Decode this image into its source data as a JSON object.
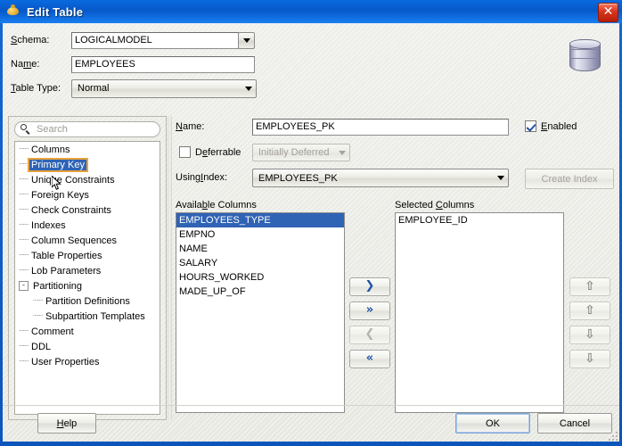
{
  "window": {
    "title": "Edit Table",
    "title_icon": "teapot-icon",
    "close_label": "✕",
    "close_icon": "close-icon",
    "side_icon": "database-cylinder-icon"
  },
  "top_form": {
    "schema": {
      "label": "Schema:",
      "value": "LOGICALMODEL",
      "dropdown_icon": "chevron-down-icon"
    },
    "name": {
      "label": "Name:",
      "value": "EMPLOYEES"
    },
    "table_type": {
      "label": "Table Type:",
      "value": "Normal",
      "dropdown_icon": "chevron-down-icon"
    }
  },
  "sidebar": {
    "search": {
      "placeholder": "Search",
      "icon": "search-icon",
      "value": ""
    },
    "tree": [
      {
        "label": "Columns",
        "indent": 0,
        "selected": false,
        "expander": ""
      },
      {
        "label": "Primary Key",
        "indent": 0,
        "selected": true,
        "expander": ""
      },
      {
        "label": "Unique Constraints",
        "indent": 0,
        "selected": false,
        "expander": ""
      },
      {
        "label": "Foreign Keys",
        "indent": 0,
        "selected": false,
        "expander": ""
      },
      {
        "label": "Check Constraints",
        "indent": 0,
        "selected": false,
        "expander": ""
      },
      {
        "label": "Indexes",
        "indent": 0,
        "selected": false,
        "expander": ""
      },
      {
        "label": "Column Sequences",
        "indent": 0,
        "selected": false,
        "expander": ""
      },
      {
        "label": "Table Properties",
        "indent": 0,
        "selected": false,
        "expander": ""
      },
      {
        "label": "Lob Parameters",
        "indent": 0,
        "selected": false,
        "expander": ""
      },
      {
        "label": "Partitioning",
        "indent": 0,
        "selected": false,
        "expander": "-"
      },
      {
        "label": "Partition Definitions",
        "indent": 1,
        "selected": false,
        "expander": ""
      },
      {
        "label": "Subpartition Templates",
        "indent": 1,
        "selected": false,
        "expander": ""
      },
      {
        "label": "Comment",
        "indent": 0,
        "selected": false,
        "expander": ""
      },
      {
        "label": "DDL",
        "indent": 0,
        "selected": false,
        "expander": ""
      },
      {
        "label": "User Properties",
        "indent": 0,
        "selected": false,
        "expander": ""
      }
    ]
  },
  "detail": {
    "name": {
      "label": "Name:",
      "value": "EMPLOYEES_PK"
    },
    "enabled": {
      "label": "Enabled",
      "checked": true
    },
    "deferrable": {
      "label": "Deferrable",
      "checked": false
    },
    "initially_deferred": {
      "value": "Initially Deferred",
      "enabled": false,
      "dropdown_icon": "chevron-down-icon"
    },
    "using_index": {
      "label": "Using Index:",
      "value": "EMPLOYEES_PK",
      "dropdown_icon": "chevron-down-icon"
    },
    "create_index": {
      "label": "Create Index",
      "enabled": false
    },
    "available_columns": {
      "label": "Available Columns",
      "items": [
        "EMPLOYEES_TYPE",
        "EMPNO",
        "NAME",
        "SALARY",
        "HOURS_WORKED",
        "MADE_UP_OF"
      ],
      "selected_index": 0
    },
    "selected_columns": {
      "label": "Selected Columns",
      "items": [
        "EMPLOYEE_ID"
      ],
      "selected_index": -1
    },
    "transfer_buttons": [
      {
        "icon": "chevron-right-icon",
        "glyph": "❯",
        "enabled": true
      },
      {
        "icon": "chevron-double-right-icon",
        "glyph": "»",
        "enabled": true
      },
      {
        "icon": "chevron-left-icon",
        "glyph": "❮",
        "enabled": false
      },
      {
        "icon": "chevron-double-left-icon",
        "glyph": "«",
        "enabled": true
      }
    ],
    "order_buttons": [
      {
        "icon": "move-to-top-icon",
        "glyph": "⇧",
        "enabled": false
      },
      {
        "icon": "move-up-icon",
        "glyph": "⇧",
        "enabled": false
      },
      {
        "icon": "move-down-icon",
        "glyph": "⇩",
        "enabled": false
      },
      {
        "icon": "move-to-bottom-icon",
        "glyph": "⇩",
        "enabled": false
      }
    ]
  },
  "buttons": {
    "help": "Help",
    "ok": "OK",
    "cancel": "Cancel"
  },
  "colors": {
    "titlebar_blue": "#0a63d6",
    "selection_blue": "#2f63b4",
    "focus_orange": "#e8a33d",
    "close_red": "#d9341b",
    "dialog_bg": "#ececE6"
  }
}
